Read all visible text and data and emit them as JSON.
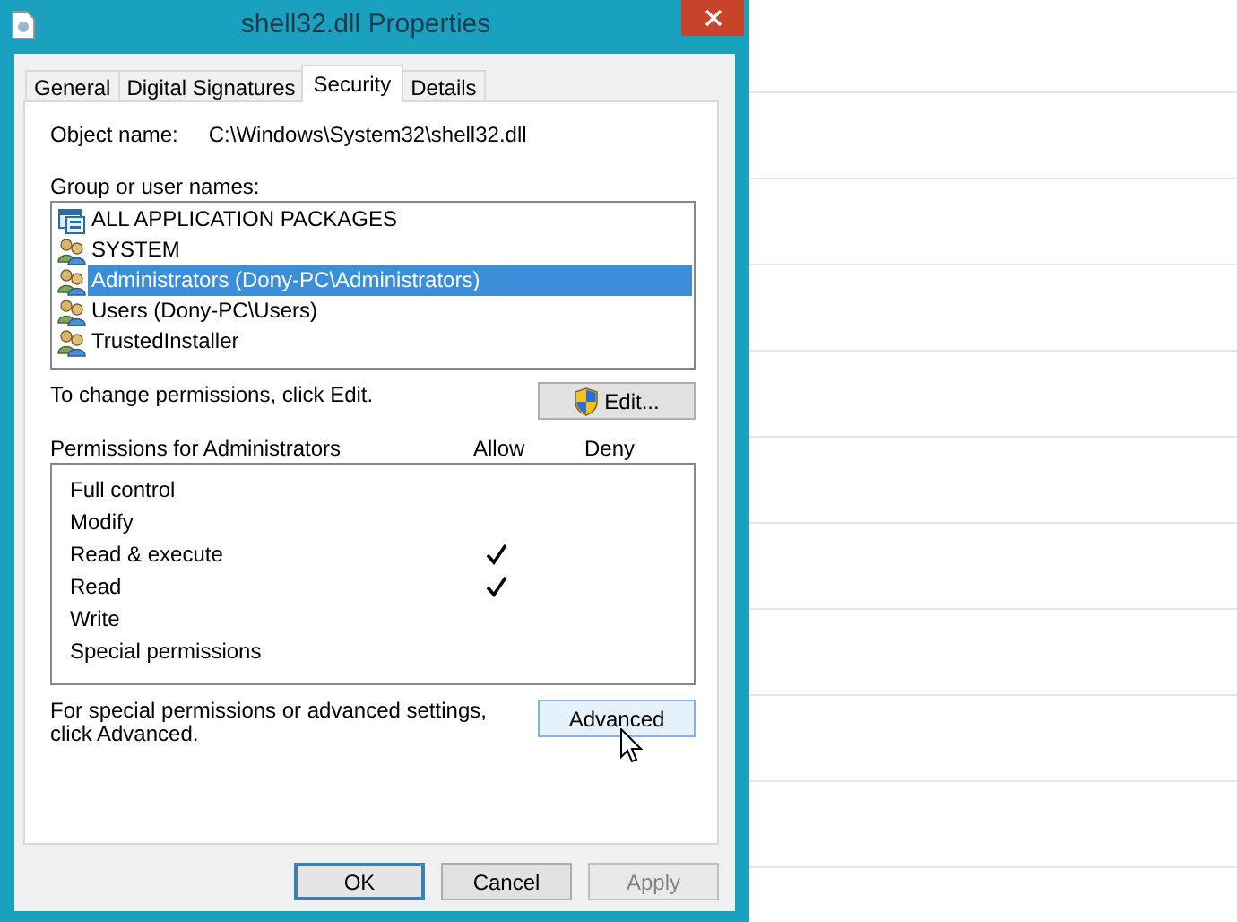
{
  "window": {
    "title": "shell32.dll Properties"
  },
  "tabs": [
    {
      "label": "General",
      "selected": false
    },
    {
      "label": "Digital Signatures",
      "selected": false
    },
    {
      "label": "Security",
      "selected": true
    },
    {
      "label": "Details",
      "selected": false
    }
  ],
  "object_name": {
    "label": "Object name:",
    "value": "C:\\Windows\\System32\\shell32.dll"
  },
  "groups": {
    "label": "Group or user names:",
    "items": [
      {
        "name": "ALL APPLICATION PACKAGES",
        "kind": "package",
        "selected": false
      },
      {
        "name": "SYSTEM",
        "kind": "group",
        "selected": false
      },
      {
        "name": "Administrators (Dony-PC\\Administrators)",
        "kind": "group",
        "selected": true
      },
      {
        "name": "Users (Dony-PC\\Users)",
        "kind": "group",
        "selected": false
      },
      {
        "name": "TrustedInstaller",
        "kind": "group",
        "selected": false
      }
    ]
  },
  "edit_hint": "To change permissions, click Edit.",
  "edit_button": {
    "label": "Edit...",
    "shield": true
  },
  "permissions": {
    "label": "Permissions for Administrators",
    "columns": [
      "Allow",
      "Deny"
    ],
    "rows": [
      {
        "name": "Full control",
        "allow": false,
        "deny": false
      },
      {
        "name": "Modify",
        "allow": false,
        "deny": false
      },
      {
        "name": "Read & execute",
        "allow": true,
        "deny": false
      },
      {
        "name": "Read",
        "allow": true,
        "deny": false
      },
      {
        "name": "Write",
        "allow": false,
        "deny": false
      },
      {
        "name": "Special permissions",
        "allow": false,
        "deny": false
      }
    ]
  },
  "advanced_hint": "For special permissions or advanced settings, click Advanced.",
  "advanced_button": {
    "label": "Advanced",
    "hovered": true
  },
  "buttons": [
    {
      "label": "OK",
      "kind": "default",
      "disabled": false
    },
    {
      "label": "Cancel",
      "kind": "normal",
      "disabled": false
    },
    {
      "label": "Apply",
      "kind": "normal",
      "disabled": true
    }
  ]
}
